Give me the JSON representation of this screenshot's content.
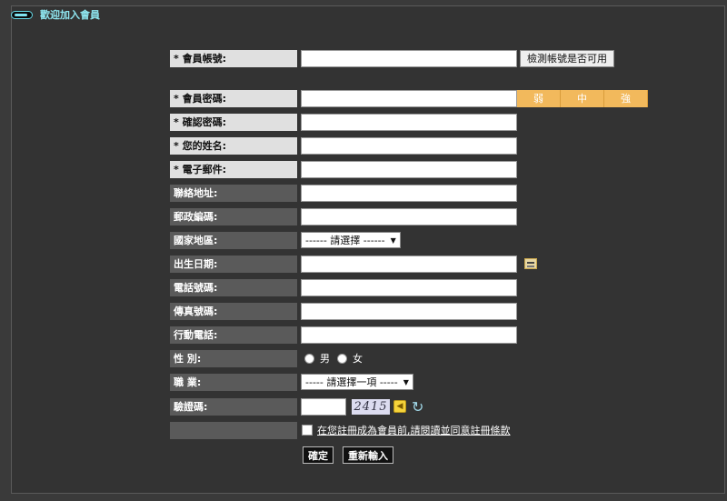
{
  "panel_title": "歡迎加入會員",
  "fields": {
    "account": {
      "label": "* 會員帳號:",
      "check_button": "檢測帳號是否可用"
    },
    "password": {
      "label": "* 會員密碼:",
      "strength": [
        "弱",
        "中",
        "強"
      ]
    },
    "confirm": {
      "label": "* 確認密碼:"
    },
    "name": {
      "label": "* 您的姓名:"
    },
    "email": {
      "label": "* 電子郵件:"
    },
    "address": {
      "label": "聯絡地址:"
    },
    "zip": {
      "label": "郵政編碼:"
    },
    "country": {
      "label": "國家地區:",
      "select": "------ 請選擇 ------"
    },
    "birthday": {
      "label": "出生日期:"
    },
    "phone": {
      "label": "電話號碼:"
    },
    "fax": {
      "label": "傳真號碼:"
    },
    "mobile": {
      "label": "行動電話:"
    },
    "gender": {
      "label": "性 別:",
      "male": "男",
      "female": "女"
    },
    "job": {
      "label": "職 業:",
      "select": "----- 請選擇一項 -----"
    },
    "captcha": {
      "label": "驗證碼:",
      "code": "2415"
    },
    "agree": {
      "text": "在您註冊成為會員前,請閱讀並同意註冊條款"
    }
  },
  "buttons": {
    "submit": "確定",
    "reset": "重新輸入"
  },
  "icons": [
    "calendar-icon",
    "speaker-icon",
    "refresh-icon"
  ]
}
